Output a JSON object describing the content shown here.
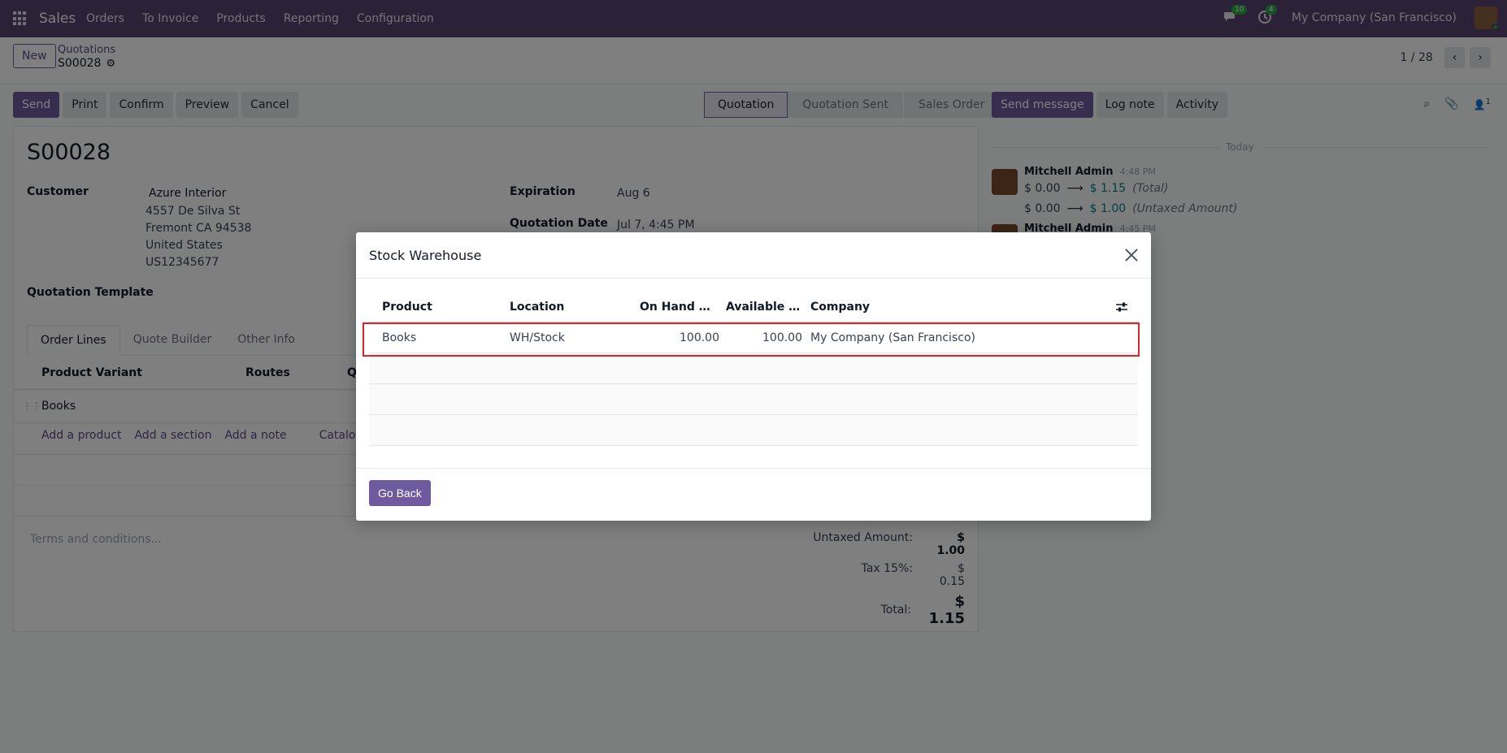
{
  "topbar": {
    "app": "Sales",
    "menu": [
      "Orders",
      "To Invoice",
      "Products",
      "Reporting",
      "Configuration"
    ],
    "messages_count": "10",
    "activities_count": "4",
    "company": "My Company (San Francisco)"
  },
  "control": {
    "new_label": "New",
    "breadcrumb_parent": "Quotations",
    "record_name": "S00028",
    "pager": "1 / 28",
    "buttons": [
      "Send",
      "Print",
      "Confirm",
      "Preview",
      "Cancel"
    ],
    "statusbar": [
      "Quotation",
      "Quotation Sent",
      "Sales Order"
    ]
  },
  "chatter": {
    "send_message": "Send message",
    "log_note": "Log note",
    "activity": "Activity",
    "followers": "1",
    "today": "Today",
    "msg1_author": "Mitchell Admin",
    "msg1_time": "4:48 PM",
    "msg1_line1_from": "$ 0.00",
    "msg1_line1_to": "$ 1.15",
    "msg1_line1_field": "(Total)",
    "msg1_line2_from": "$ 0.00",
    "msg1_line2_to": "$ 1.00",
    "msg1_line2_field": "(Untaxed Amount)",
    "msg2_author": "Mitchell Admin",
    "msg2_time": "4:45 PM"
  },
  "form": {
    "title": "S00028",
    "customer_label": "Customer",
    "customer_name": "Azure Interior",
    "addr1": "4557 De Silva St",
    "addr2": "Fremont CA 94538",
    "addr3": "United States",
    "addr4": "US12345677",
    "expiration_label": "Expiration",
    "expiration_value": "Aug 6",
    "quotation_date_label": "Quotation Date",
    "quotation_date_value": "Jul 7, 4:45 PM",
    "template_label": "Quotation Template",
    "tabs": [
      "Order Lines",
      "Quote Builder",
      "Other Info"
    ],
    "col_variant": "Product Variant",
    "col_routes": "Routes",
    "col_q": "Q",
    "line_product": "Books",
    "add_product": "Add a product",
    "add_section": "Add a section",
    "add_note": "Add a note",
    "catalog": "Catalog",
    "terms_placeholder": "Terms and conditions...",
    "untaxed_label": "Untaxed Amount:",
    "untaxed_value": "$ 1.00",
    "tax_label": "Tax 15%:",
    "tax_value": "$ 0.15",
    "total_label": "Total:",
    "total_value": "$ 1.15"
  },
  "modal": {
    "title": "Stock Warehouse",
    "columns": {
      "product": "Product",
      "location": "Location",
      "on_hand": "On Hand Quantity",
      "available": "Available Quantity",
      "company": "Company"
    },
    "rows": [
      {
        "product": "Books",
        "location": "WH/Stock",
        "on_hand": "100.00",
        "available": "100.00",
        "company": "My Company (San Francisco)"
      }
    ],
    "go_back": "Go Back"
  },
  "colors": {
    "topbar": "#57446f",
    "primary": "#6f5a9f",
    "highlight": "#e02424",
    "link": "#017e84"
  }
}
